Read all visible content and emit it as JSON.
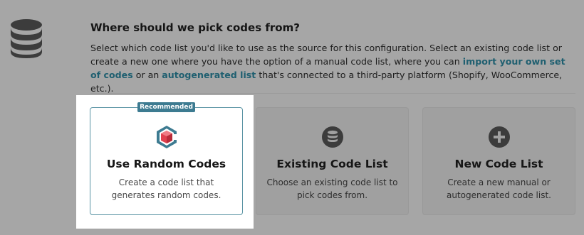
{
  "section": {
    "heading": "Where should we pick codes from?",
    "description_part1": "Select which code list you'd like to use as the source for this configuration. Select an existing code list or create a new one where you have the option of a manual code list, where you can ",
    "link_import": "import your own set of codes",
    "description_part2": " or an ",
    "link_autogenerated": "autogenerated list",
    "description_part3": " that's connected to a third-party platform (Shopify, WooCommerce, etc.)."
  },
  "options": [
    {
      "title": "Use Random Codes",
      "description": "Create a code list that generates random codes.",
      "badge": "Recommended",
      "icon": "random-codes-logo-icon",
      "selected": true
    },
    {
      "title": "Existing Code List",
      "description": "Choose an existing code list to pick codes from.",
      "icon": "database-icon",
      "selected": false
    },
    {
      "title": "New Code List",
      "description": "Create a new manual or autogenerated code list.",
      "icon": "plus-circle-icon",
      "selected": false
    }
  ],
  "colors": {
    "overlay": "#a6a6a6",
    "accent": "#3d7b91",
    "link": "#1f5f70",
    "logo_red": "#e0404e"
  }
}
